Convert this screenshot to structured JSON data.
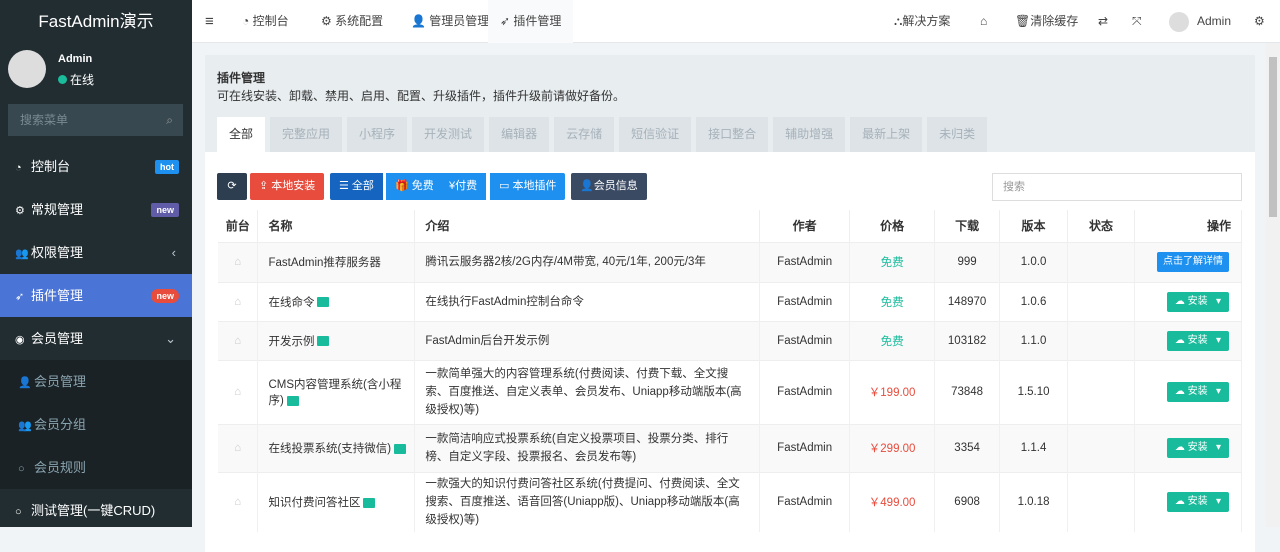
{
  "app_title": "FastAdmin演示",
  "user": {
    "name": "Admin",
    "status": "在线"
  },
  "search_menu_placeholder": "搜索菜单",
  "sidebar": [
    {
      "label": "控制台",
      "badge": "hot",
      "badge_color": "#1e90ef"
    },
    {
      "label": "常规管理",
      "badge": "new",
      "badge_color": "#605ca8"
    },
    {
      "label": "权限管理"
    },
    {
      "label": "插件管理",
      "badge": "new",
      "badge_color": "#e74c3c"
    },
    {
      "label": "会员管理"
    },
    {
      "label": "会员管理"
    },
    {
      "label": "会员分组"
    },
    {
      "label": "会员规则"
    },
    {
      "label": "测试管理(一键CRUD)"
    }
  ],
  "topnav": [
    "控制台",
    "系统配置",
    "管理员管理",
    "插件管理"
  ],
  "topright": {
    "solutions": "解决方案",
    "clear_cache": "清除缓存",
    "user": "Admin"
  },
  "panel": {
    "title": "插件管理",
    "desc": "可在线安装、卸载、禁用、启用、配置、升级插件，插件升级前请做好备份。"
  },
  "tabs": [
    "全部",
    "完整应用",
    "小程序",
    "开发测试",
    "编辑器",
    "云存储",
    "短信验证",
    "接口整合",
    "辅助增强",
    "最新上架",
    "未归类"
  ],
  "toolbar": {
    "local_install": "本地安装",
    "all": "全部",
    "free": "免费",
    "paid": "付费",
    "local_plugins": "本地插件",
    "member_info": "会员信息",
    "search_placeholder": "搜索"
  },
  "columns": [
    "前台",
    "名称",
    "介绍",
    "作者",
    "价格",
    "下载",
    "版本",
    "状态",
    "操作"
  ],
  "rows": [
    {
      "name": "FastAdmin推荐服务器",
      "intro": "腾讯云服务器2核/2G内存/4M带宽, 40元/1年, 200元/3年",
      "author": "FastAdmin",
      "price": "免费",
      "downloads": "999",
      "version": "1.0.0",
      "action": "点击了解详情"
    },
    {
      "name": "在线命令",
      "intro": "在线执行FastAdmin控制台命令",
      "author": "FastAdmin",
      "price": "免费",
      "downloads": "148970",
      "version": "1.0.6",
      "action": "安装"
    },
    {
      "name": "开发示例",
      "intro": "FastAdmin后台开发示例",
      "author": "FastAdmin",
      "price": "免费",
      "downloads": "103182",
      "version": "1.1.0",
      "action": "安装"
    },
    {
      "name": "CMS内容管理系统(含小程序)",
      "intro": "一款简单强大的内容管理系统(付费阅读、付费下载、全文搜索、百度推送、自定义表单、会员发布、Uniapp移动端版本(高级授权)等)",
      "author": "FastAdmin",
      "price": "￥199.00",
      "downloads": "73848",
      "version": "1.5.10",
      "action": "安装"
    },
    {
      "name": "在线投票系统(支持微信)",
      "intro": "一款简洁响应式投票系统(自定义投票项目、投票分类、排行榜、自定义字段、投票报名、会员发布等)",
      "author": "FastAdmin",
      "price": "￥299.00",
      "downloads": "3354",
      "version": "1.1.4",
      "action": "安装"
    },
    {
      "name": "知识付费问答社区",
      "intro": "一款强大的知识付费问答社区系统(付费提问、付费阅读、全文搜索、百度推送、语音回答(Uniapp版)、Uniapp移动端版本(高级授权)等)",
      "author": "FastAdmin",
      "price": "￥499.00",
      "downloads": "6908",
      "version": "1.0.18",
      "action": "安装"
    }
  ]
}
